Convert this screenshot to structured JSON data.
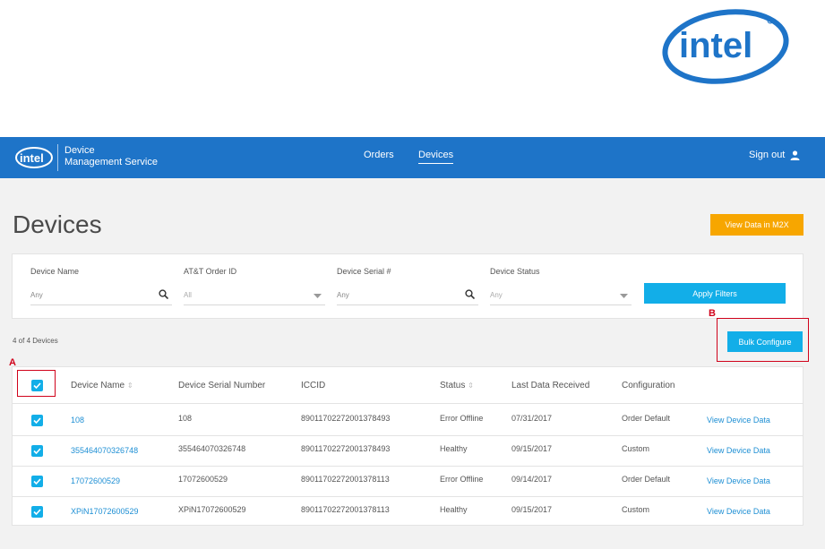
{
  "brand": {
    "logo_text": "intel"
  },
  "navbar": {
    "logo_text": "intel",
    "title_line1": "Device",
    "title_line2": "Management Service",
    "links": [
      {
        "label": "Orders"
      },
      {
        "label": "Devices"
      }
    ],
    "sign_out_label": "Sign out"
  },
  "page": {
    "title": "Devices",
    "m2x_button": "View Data in M2X"
  },
  "filters": {
    "device_name": {
      "label": "Device Name",
      "value": "Any"
    },
    "order_id": {
      "label": "AT&T Order ID",
      "value": "All"
    },
    "serial": {
      "label": "Device Serial #",
      "value": "Any"
    },
    "status": {
      "label": "Device Status",
      "value": "Any"
    },
    "apply_label": "Apply Filters"
  },
  "list": {
    "count_text": "4 of 4 Devices",
    "bulk_button": "Bulk Configure",
    "marker_a": "A",
    "marker_b": "B"
  },
  "table": {
    "headers": {
      "name": "Device Name",
      "serial": "Device Serial Number",
      "iccid": "ICCID",
      "status": "Status",
      "last": "Last Data Received",
      "config": "Configuration"
    },
    "rows": [
      {
        "name": "108",
        "serial": "108",
        "iccid": "89011702272001378493",
        "status": "Error Offline",
        "last": "07/31/2017",
        "config": "Order Default",
        "action": "View Device Data"
      },
      {
        "name": "355464070326748",
        "serial": "355464070326748",
        "iccid": "89011702272001378493",
        "status": "Healthy",
        "last": "09/15/2017",
        "config": "Custom",
        "action": "View Device Data"
      },
      {
        "name": "17072600529",
        "serial": "17072600529",
        "iccid": "89011702272001378113",
        "status": "Error Offline",
        "last": "09/14/2017",
        "config": "Order Default",
        "action": "View Device Data"
      },
      {
        "name": "XPiN17072600529",
        "serial": "XPiN17072600529",
        "iccid": "89011702272001378113",
        "status": "Healthy",
        "last": "09/15/2017",
        "config": "Custom",
        "action": "View Device Data"
      }
    ]
  },
  "colors": {
    "navbar": "#1e74c8",
    "primary_button": "#12aee8",
    "m2x_button": "#f7a600",
    "link": "#1e8fd4",
    "marker": "#d0021b"
  }
}
